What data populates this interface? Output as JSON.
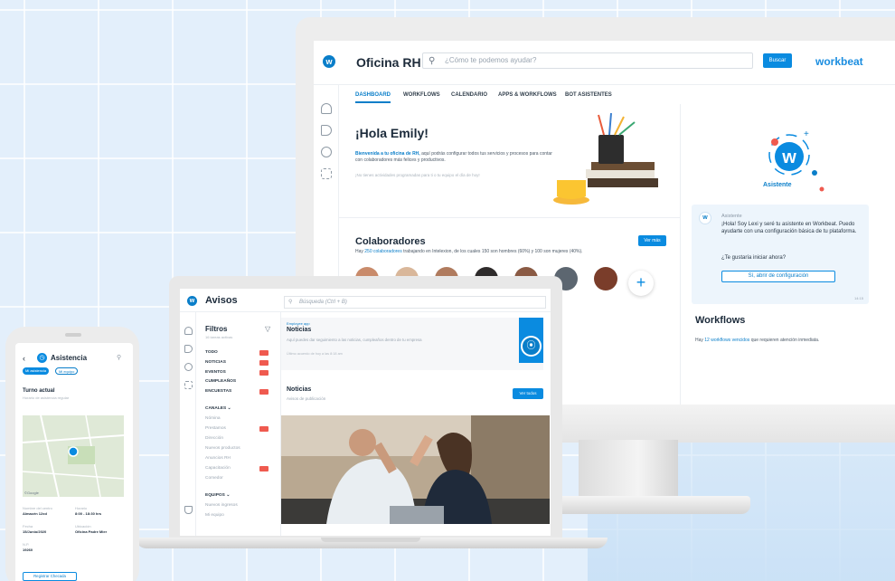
{
  "colors": {
    "accent": "#0a8be0",
    "badge": "#ef5a4f",
    "background": "#e3effb"
  },
  "monitor": {
    "app_title": "Oficina RH",
    "search_placeholder": "¿Cómo te podemos ayudar?",
    "search_button": "Buscar",
    "brand": "workbeat",
    "tabs": [
      "DASHBOARD",
      "WORKFLOWS",
      "CALENDARIO",
      "APPS & WORKFLOWS",
      "BOT ASISTENTES"
    ],
    "active_tab": "DASHBOARD",
    "nav_icons": [
      "home-icon",
      "megaphone-icon",
      "chat-icon",
      "grid-icon"
    ],
    "greeting": "¡Hola Emily!",
    "welcome_bold": "Bienvenida a tu oficina de RH,",
    "welcome_rest": " aquí podrás configurar todos tus servicios y procesos para contar con colaboradores más felices y productivos.",
    "no_activities": "¡No tienes actividades programadas para ti o tu equipo el día de hoy!",
    "colaboradores": {
      "title": "Colaboradores",
      "sub_prefix": "Hay ",
      "sub_link": "250 colaboradores",
      "sub_rest": " trabajando en Intelexion, de los cuales 150 son hombres (60%) y 100 son mujeres (40%).",
      "button": "Ver más",
      "add": "+"
    },
    "assistant": {
      "label": "Asistente",
      "name": "Asistente",
      "message": "¡Hola! Soy Lexi y seré tu asistente en Workbeat. Puedo ayudarte con una configuración básica de tu plataforma.",
      "question": "¿Te gustaría iniciar ahora?",
      "button": "Sí, abrir de configuración",
      "time": "14:15"
    },
    "workflows": {
      "title": "Workflows",
      "sub_prefix": "Hay ",
      "sub_link": "12 workflows vencidos",
      "sub_rest": " que requieren atención inmediata."
    }
  },
  "laptop": {
    "app_title": "Avisos",
    "search_placeholder": "Búsqueda (Ctrl + B)",
    "filters": {
      "title": "Filtros",
      "subtitle": "16 tareas activas",
      "items": [
        "TODO",
        "NOTICIAS",
        "EVENTOS",
        "CUMPLEAÑOS",
        "ENCUESTAS"
      ],
      "canales_header": "CANALES",
      "canales": [
        "Nómina",
        "Prestamos",
        "Dirección",
        "Nuevos productos",
        "Anuncios RH",
        "Capacitación",
        "Comedor"
      ],
      "equipos_header": "EQUIPOS",
      "equipos": [
        "Nuevos ingresos",
        "Mi equipo"
      ]
    },
    "news_card": {
      "eyebrow": "Employee app",
      "title": "Noticias",
      "desc": "Aquí puedes dar seguimiento a las noticias, cumpleaños dentro de tu empresa",
      "footer": "Último acuerdo de hoy a las 8:18 am"
    },
    "noticias": {
      "title": "Noticias",
      "subtitle": "Avisos de publicación",
      "button": "Ver todos"
    },
    "brand": "workbeat"
  },
  "phone": {
    "title": "Asistencia",
    "chips": [
      "Mi asistencia",
      "Mi equipo"
    ],
    "section": "Turno actual",
    "section_sub": "Horario de asistencia regular",
    "fields": [
      {
        "k": "Nombre del centro",
        "v": "Almacén 12xd"
      },
      {
        "k": "Horario",
        "v": "8:00 - 18:30 hrs"
      },
      {
        "k": "Fecha",
        "v": "15/Junio/2020"
      },
      {
        "k": "Ubicación",
        "v": "Oficina Padre Mier"
      },
      {
        "k": "N.P.",
        "v": "19260"
      }
    ],
    "button": "Registrar Checada",
    "map_credit": "©Google"
  }
}
